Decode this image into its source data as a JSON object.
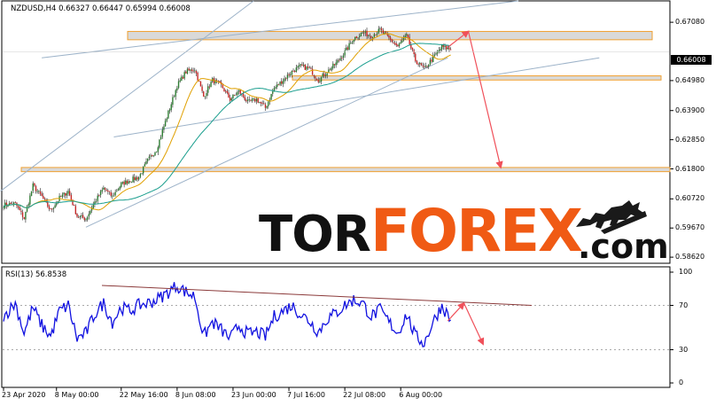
{
  "header": {
    "symbol_line": "NZDUSD,H4  0.66327 0.66447 0.65994 0.66008",
    "current_price": "0.66008"
  },
  "rsi_header": "RSI(13) 56.8538",
  "logo": {
    "part1": "TOR",
    "part2": "FOREX",
    "part3": ".com"
  },
  "colors": {
    "bull": "#2e7d32",
    "bear": "#c62828",
    "ma_fast": "#e0a000",
    "ma_slow": "#1a9e8e",
    "channel": "#9db3c9",
    "zone_border": "#f0a030",
    "arrow": "#f0505a",
    "rsi": "#1010e0",
    "rsi_trend": "#8b3a3a",
    "logo_orange": "#f05a14"
  },
  "chart_data": [
    {
      "type": "candlestick",
      "title": "NZDUSD,H4",
      "price_levels": [
        "0.67080",
        "0.66008",
        "0.64980",
        "0.63900",
        "0.62850",
        "0.61800",
        "0.60720",
        "0.59670",
        "0.58620"
      ],
      "x_ticks": [
        "23 Apr 2020",
        "8 May 00:00",
        "22 May 16:00",
        "8 Jun 08:00",
        "23 Jun 00:00",
        "7 Jul 16:00",
        "22 Jul 08:00",
        "6 Aug 00:00"
      ],
      "close_anchors": [
        [
          0,
          0.605
        ],
        [
          8,
          0.6055
        ],
        [
          14,
          0.6002
        ],
        [
          20,
          0.612
        ],
        [
          26,
          0.608
        ],
        [
          32,
          0.603
        ],
        [
          38,
          0.6075
        ],
        [
          44,
          0.61
        ],
        [
          50,
          0.601
        ],
        [
          56,
          0.6
        ],
        [
          62,
          0.606
        ],
        [
          68,
          0.611
        ],
        [
          74,
          0.608
        ],
        [
          80,
          0.6125
        ],
        [
          86,
          0.614
        ],
        [
          92,
          0.615
        ],
        [
          98,
          0.621
        ],
        [
          104,
          0.625
        ],
        [
          110,
          0.635
        ],
        [
          118,
          0.648
        ],
        [
          124,
          0.653
        ],
        [
          130,
          0.654
        ],
        [
          136,
          0.644
        ],
        [
          142,
          0.65
        ],
        [
          148,
          0.648
        ],
        [
          154,
          0.643
        ],
        [
          160,
          0.646
        ],
        [
          166,
          0.642
        ],
        [
          172,
          0.643
        ],
        [
          178,
          0.64
        ],
        [
          184,
          0.647
        ],
        [
          190,
          0.65
        ],
        [
          196,
          0.653
        ],
        [
          202,
          0.655
        ],
        [
          208,
          0.654
        ],
        [
          214,
          0.65
        ],
        [
          220,
          0.653
        ],
        [
          226,
          0.656
        ],
        [
          232,
          0.66
        ],
        [
          238,
          0.665
        ],
        [
          244,
          0.667
        ],
        [
          250,
          0.666
        ],
        [
          256,
          0.668
        ],
        [
          262,
          0.665
        ],
        [
          268,
          0.662
        ],
        [
          274,
          0.666
        ],
        [
          280,
          0.657
        ],
        [
          286,
          0.654
        ],
        [
          292,
          0.658
        ],
        [
          298,
          0.662
        ],
        [
          304,
          0.661
        ]
      ],
      "resistance_zone": [
        0.6645,
        0.6675
      ],
      "middle_zone": [
        0.65,
        0.6515
      ],
      "support_zone": [
        0.617,
        0.6185
      ],
      "forecast": [
        [
          0.6675,
          0.6185
        ]
      ]
    },
    {
      "type": "line",
      "title": "RSI(13)",
      "y_ticks": [
        "100",
        "70",
        "30",
        "0"
      ],
      "ylim": [
        0,
        100
      ],
      "value_anchors": [
        [
          0,
          60
        ],
        [
          8,
          72
        ],
        [
          14,
          45
        ],
        [
          20,
          68
        ],
        [
          26,
          52
        ],
        [
          32,
          42
        ],
        [
          38,
          65
        ],
        [
          44,
          70
        ],
        [
          50,
          40
        ],
        [
          56,
          45
        ],
        [
          62,
          62
        ],
        [
          68,
          72
        ],
        [
          74,
          55
        ],
        [
          80,
          68
        ],
        [
          86,
          65
        ],
        [
          92,
          70
        ],
        [
          98,
          72
        ],
        [
          104,
          75
        ],
        [
          110,
          80
        ],
        [
          118,
          88
        ],
        [
          124,
          82
        ],
        [
          130,
          78
        ],
        [
          136,
          42
        ],
        [
          142,
          55
        ],
        [
          148,
          48
        ],
        [
          154,
          40
        ],
        [
          160,
          52
        ],
        [
          166,
          44
        ],
        [
          172,
          46
        ],
        [
          178,
          42
        ],
        [
          184,
          60
        ],
        [
          190,
          65
        ],
        [
          196,
          70
        ],
        [
          202,
          62
        ],
        [
          208,
          56
        ],
        [
          214,
          46
        ],
        [
          220,
          58
        ],
        [
          226,
          63
        ],
        [
          232,
          70
        ],
        [
          238,
          75
        ],
        [
          244,
          72
        ],
        [
          250,
          60
        ],
        [
          256,
          66
        ],
        [
          262,
          55
        ],
        [
          268,
          45
        ],
        [
          274,
          62
        ],
        [
          280,
          42
        ],
        [
          286,
          36
        ],
        [
          292,
          55
        ],
        [
          298,
          70
        ],
        [
          304,
          56.85
        ]
      ],
      "trendline": [
        88,
        72
      ],
      "forecast": [
        [
          72,
          35
        ]
      ]
    }
  ]
}
